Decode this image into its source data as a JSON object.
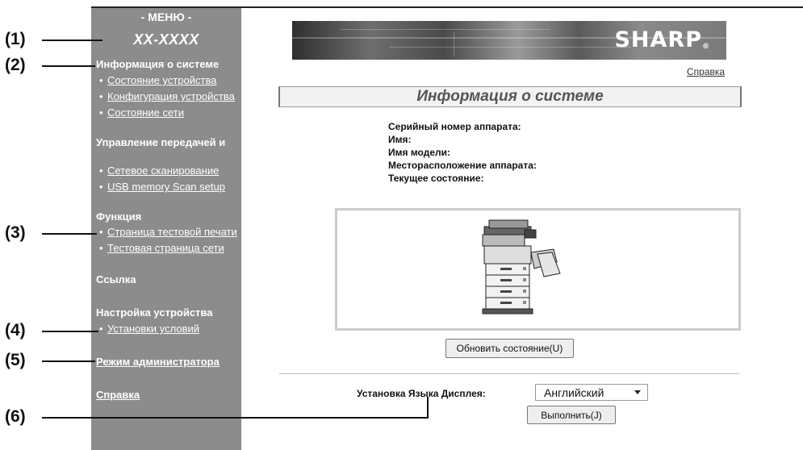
{
  "menu": {
    "title": "- МЕНЮ -",
    "model": "XX-XXXX",
    "sections": {
      "system_info": "Информация о системе",
      "system_items": [
        "Состояние устройства",
        "Конфигурация устройства",
        "Состояние сети"
      ],
      "transfer": "Управление передачей и",
      "transfer_items": [
        "Сетевое сканирование",
        "USB memory Scan setup"
      ],
      "function": "Функция",
      "function_items": [
        "Страница тестовой печати",
        "Тестовая страница сети"
      ],
      "link": "Ссылка",
      "device_settings": "Настройка устройства",
      "device_items": [
        "Установки условий"
      ],
      "admin_mode": "Режим администратора",
      "help": "Справка"
    }
  },
  "callouts": [
    "(1)",
    "(2)",
    "(3)",
    "(4)",
    "(5)",
    "(6)"
  ],
  "header": {
    "brand": "SHARP",
    "help_link": "Справка"
  },
  "main": {
    "title": "Информация о системе",
    "info_labels": [
      "Серийный номер аппарата:",
      "Имя:",
      "Имя модели:",
      "Месторасположение аппарата:",
      "Текущее состояние:"
    ],
    "refresh_button": "Обновить состояние(U)",
    "language_label": "Установка Языка Дисплея:",
    "language_value": "Английский",
    "execute_button": "Выполнить(J)"
  }
}
